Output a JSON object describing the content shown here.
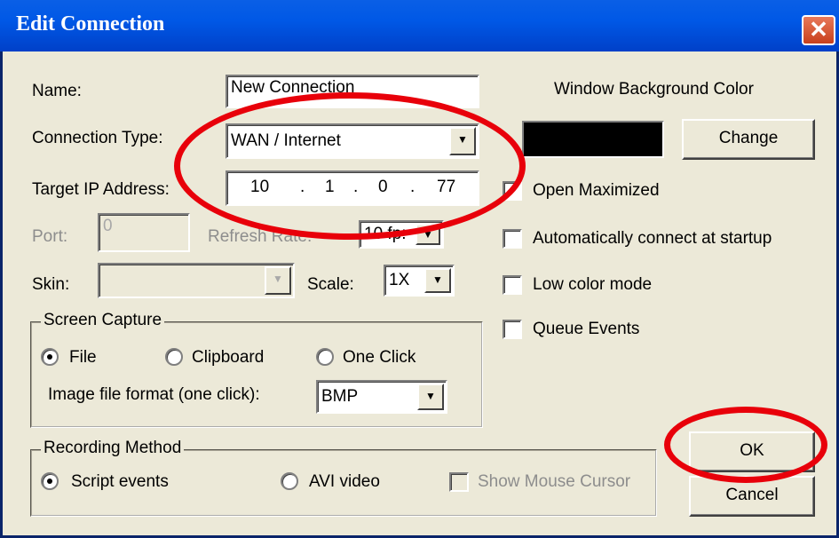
{
  "window": {
    "title": "Edit Connection",
    "close_glyph": "✕"
  },
  "fields": {
    "name_label": "Name:",
    "name_value": "New Connection",
    "connection_type_label": "Connection Type:",
    "connection_type_value": "WAN / Internet",
    "target_ip_label": "Target IP Address:",
    "ip_octets": [
      "10",
      "1",
      "0",
      "77"
    ],
    "ip_dot": ".",
    "port_label": "Port:",
    "port_value": "0",
    "refresh_rate_label": "Refresh Rate:",
    "refresh_rate_value": "10 fp:",
    "skin_label": "Skin:",
    "skin_value": "",
    "scale_label": "Scale:",
    "scale_value": "1X"
  },
  "screen_capture": {
    "title": "Screen Capture",
    "options": [
      "File",
      "Clipboard",
      "One Click"
    ],
    "selected": "File",
    "image_format_label": "Image file format (one click):",
    "image_format_value": "BMP"
  },
  "recording": {
    "title": "Recording Method",
    "options": [
      "Script events",
      "AVI video"
    ],
    "selected": "Script events",
    "show_cursor_label": "Show Mouse Cursor"
  },
  "right_panel": {
    "bg_color_label": "Window Background Color",
    "bg_color": "#000000",
    "change_label": "Change",
    "checkboxes": [
      {
        "label": "Open Maximized",
        "checked": false
      },
      {
        "label": "Automatically connect at startup",
        "checked": false
      },
      {
        "label": "Low color mode",
        "checked": false
      },
      {
        "label": "Queue Events",
        "checked": false
      }
    ]
  },
  "buttons": {
    "ok": "OK",
    "cancel": "Cancel"
  },
  "annotation_color": "#e8000a",
  "dropdown_arrow": "▼"
}
